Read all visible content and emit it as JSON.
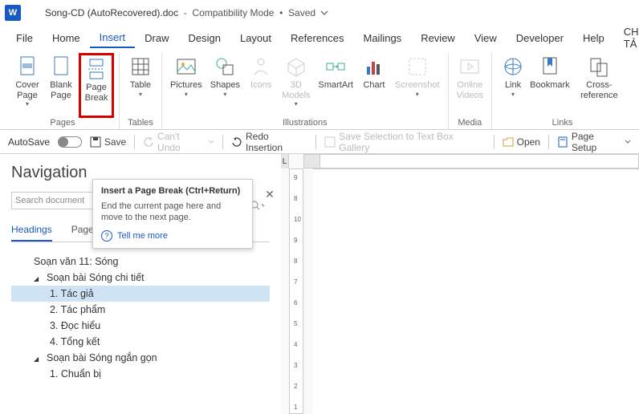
{
  "titlebar": {
    "filename": "Song-CD (AutoRecovered).doc",
    "mode": "Compatibility Mode",
    "status": "Saved"
  },
  "menubar": {
    "items": [
      "File",
      "Home",
      "Insert",
      "Draw",
      "Design",
      "Layout",
      "References",
      "Mailings",
      "Review",
      "View",
      "Developer",
      "Help",
      "CHÍNH TẢ"
    ],
    "active_index": 2
  },
  "ribbon": {
    "groups": [
      {
        "label": "Pages",
        "items": [
          {
            "label": "Cover Page",
            "dropdown": true,
            "icon": "cover-page-icon"
          },
          {
            "label": "Blank Page",
            "icon": "blank-page-icon"
          },
          {
            "label": "Page Break",
            "icon": "page-break-icon",
            "highlighted": true
          }
        ]
      },
      {
        "label": "Tables",
        "items": [
          {
            "label": "Table",
            "dropdown": true,
            "icon": "table-icon"
          }
        ]
      },
      {
        "label": "Illustrations",
        "items": [
          {
            "label": "Pictures",
            "dropdown": true,
            "icon": "pictures-icon"
          },
          {
            "label": "Shapes",
            "dropdown": true,
            "icon": "shapes-icon"
          },
          {
            "label": "Icons",
            "icon": "icons-icon",
            "disabled": true
          },
          {
            "label": "3D Models",
            "dropdown": true,
            "icon": "3d-icon",
            "disabled": true
          },
          {
            "label": "SmartArt",
            "icon": "smartart-icon"
          },
          {
            "label": "Chart",
            "icon": "chart-icon"
          },
          {
            "label": "Screenshot",
            "dropdown": true,
            "icon": "screenshot-icon",
            "disabled": true
          }
        ]
      },
      {
        "label": "Media",
        "items": [
          {
            "label": "Online Videos",
            "icon": "video-icon",
            "disabled": true
          }
        ]
      },
      {
        "label": "Links",
        "items": [
          {
            "label": "Link",
            "dropdown": true,
            "icon": "link-icon"
          },
          {
            "label": "Bookmark",
            "icon": "bookmark-icon"
          },
          {
            "label": "Cross-reference",
            "icon": "crossref-icon"
          }
        ]
      }
    ]
  },
  "qat": {
    "autosave": "AutoSave",
    "save": "Save",
    "undo": "Can't Undo",
    "redo": "Redo Insertion",
    "save_selection": "Save Selection to Text Box Gallery",
    "open": "Open",
    "page_setup": "Page Setup"
  },
  "navpane": {
    "title": "Navigation",
    "search_placeholder": "Search document",
    "tabs": [
      "Headings",
      "Pages",
      "Results"
    ],
    "active_tab": 0,
    "tree": [
      {
        "level": 1,
        "text": "Soạn văn 11: Sóng"
      },
      {
        "level": 1,
        "text": "Soạn bài Sóng chi tiết",
        "caret": true
      },
      {
        "level": 2,
        "text": "1. Tác giả",
        "selected": true
      },
      {
        "level": 2,
        "text": "2. Tác phẩm"
      },
      {
        "level": 2,
        "text": "3. Đọc hiểu"
      },
      {
        "level": 2,
        "text": "4. Tổng kết"
      },
      {
        "level": 1,
        "text": "Soạn bài Sóng ngắn gọn",
        "caret": true
      },
      {
        "level": 2,
        "text": "1. Chuẩn bị"
      }
    ]
  },
  "tooltip": {
    "title": "Insert a Page Break (Ctrl+Return)",
    "body": "End the current page here and move to the next page.",
    "tell": "Tell me more"
  },
  "ruler_h": {
    "labels": [
      "9",
      "8",
      "10",
      "9",
      "8",
      "7",
      "6",
      "5",
      "4",
      "3",
      "2",
      "1"
    ]
  }
}
